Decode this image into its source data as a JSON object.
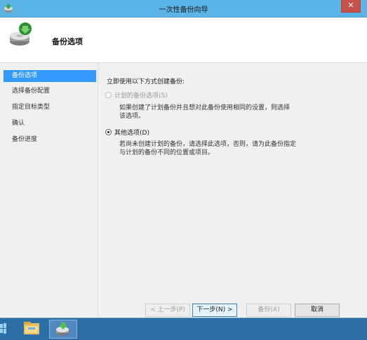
{
  "window": {
    "title": "一次性备份向导",
    "close_label": "✕"
  },
  "header": {
    "title": "备份选项",
    "icon": "backup-wizard-icon"
  },
  "sidebar": {
    "items": [
      {
        "label": "备份选项",
        "active": true
      },
      {
        "label": "选择备份配置",
        "active": false
      },
      {
        "label": "指定目标类型",
        "active": false
      },
      {
        "label": "确认",
        "active": false
      },
      {
        "label": "备份进度",
        "active": false
      }
    ]
  },
  "content": {
    "prompt": "立即使用以下方式创建备份:",
    "options": [
      {
        "label": "计划的备份选项(S)",
        "description": [
          "如果创建了计划备份并且想对此备份使用相同的设置，则选择",
          "该选项。"
        ],
        "enabled": false,
        "checked": false
      },
      {
        "label": "其他选项(D)",
        "description": [
          "若尚未创建计划的备份，请选择此选项，否则，请为此备份指定",
          "与计划的备份不同的位置或项目。"
        ],
        "enabled": true,
        "checked": true
      }
    ]
  },
  "buttons": {
    "prev": "< 上一步(P)",
    "next": "下一步(N) >",
    "backup": "备份(A)",
    "cancel": "取消"
  },
  "taskbar": {
    "items": [
      "file-explorer-icon",
      "backup-app-icon"
    ]
  },
  "colors": {
    "titlebar": "#5ab4e6",
    "accent": "#3399ff",
    "taskbar": "#2c6fa6"
  }
}
